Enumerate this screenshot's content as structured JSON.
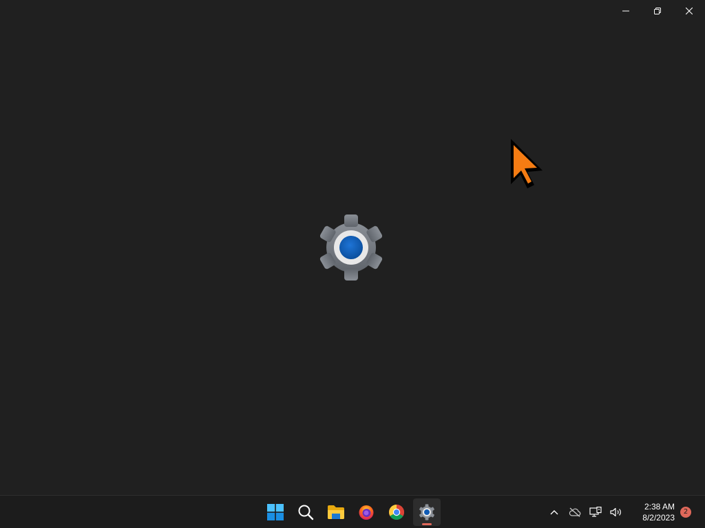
{
  "window": {
    "app": "Settings",
    "state": "loading-splash",
    "background_color": "#202020",
    "caption": {
      "minimize_icon": "minimize-icon",
      "restore_icon": "restore-icon",
      "close_icon": "close-icon"
    }
  },
  "splash": {
    "icon": "settings-gear-icon",
    "accent_color": "#0f5bb5"
  },
  "cursor": {
    "icon": "arrow-pointer-icon",
    "color": "#f57c13"
  },
  "taskbar": {
    "apps": [
      {
        "name": "Start",
        "icon": "windows-start-icon",
        "active": false
      },
      {
        "name": "Search",
        "icon": "search-icon",
        "active": false
      },
      {
        "name": "File Explorer",
        "icon": "folder-icon",
        "active": false
      },
      {
        "name": "Firefox",
        "icon": "firefox-icon",
        "active": false
      },
      {
        "name": "Chrome",
        "icon": "chrome-icon",
        "active": false
      },
      {
        "name": "Settings",
        "icon": "settings-gear-icon",
        "active": true
      }
    ],
    "tray": {
      "icons": [
        "chevron-up-icon",
        "cloud-offline-icon",
        "network-icon",
        "volume-icon"
      ],
      "time": "2:38 AM",
      "date": "8/2/2023",
      "notification_count": "2",
      "notification_color": "#e0685a"
    }
  }
}
